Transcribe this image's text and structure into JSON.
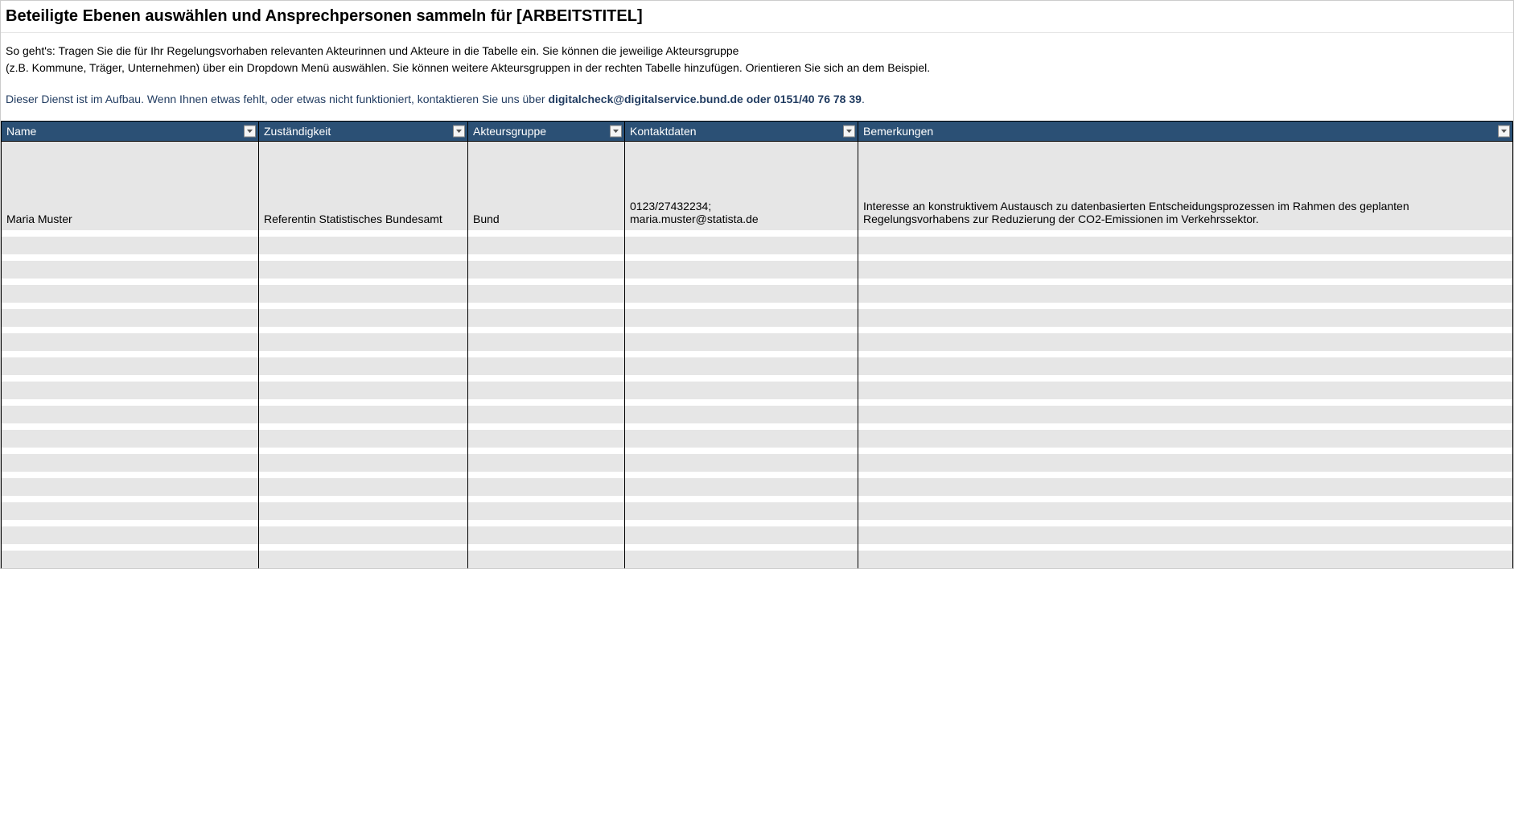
{
  "title": "Beteiligte Ebenen auswählen und Ansprechpersonen sammeln für [ARBEITSTITEL]",
  "description": {
    "line1": "So geht's: Tragen Sie die für Ihr Regelungsvorhaben relevanten Akteurinnen und Akteure in die Tabelle ein. Sie können die jeweilige Akteursgruppe",
    "line2": "(z.B. Kommune, Träger, Unternehmen) über ein Dropdown Menü auswählen. Sie können weitere Akteursgruppen in der rechten Tabelle hinzufügen. Orientieren Sie sich an dem Beispiel."
  },
  "notice": {
    "prefix": "Dieser Dienst ist im Aufbau. Wenn Ihnen etwas fehlt, oder etwas nicht funktioniert, kontaktieren Sie uns über ",
    "bold": "digitalcheck@digitalservice.bund.de oder 0151/40 76 78 39",
    "suffix": "."
  },
  "columns": {
    "name": "Name",
    "zustaendigkeit": "Zuständigkeit",
    "akteursgruppe": "Akteursgruppe",
    "kontaktdaten": "Kontaktdaten",
    "bemerkungen": "Bemerkungen"
  },
  "rows": [
    {
      "name": "Maria Muster",
      "zustaendigkeit": "Referentin Statistisches Bundesamt",
      "akteursgruppe": "Bund",
      "kontaktdaten": "0123/27432234;\nmaria.muster@statista.de",
      "bemerkungen": "Interesse an konstruktivem Austausch zu datenbasierten Entscheidungsprozessen im Rahmen des geplanten Regelungsvorhabens zur Reduzierung der CO2-Emissionen im Verkehrssektor."
    }
  ],
  "empty_row_count": 14
}
